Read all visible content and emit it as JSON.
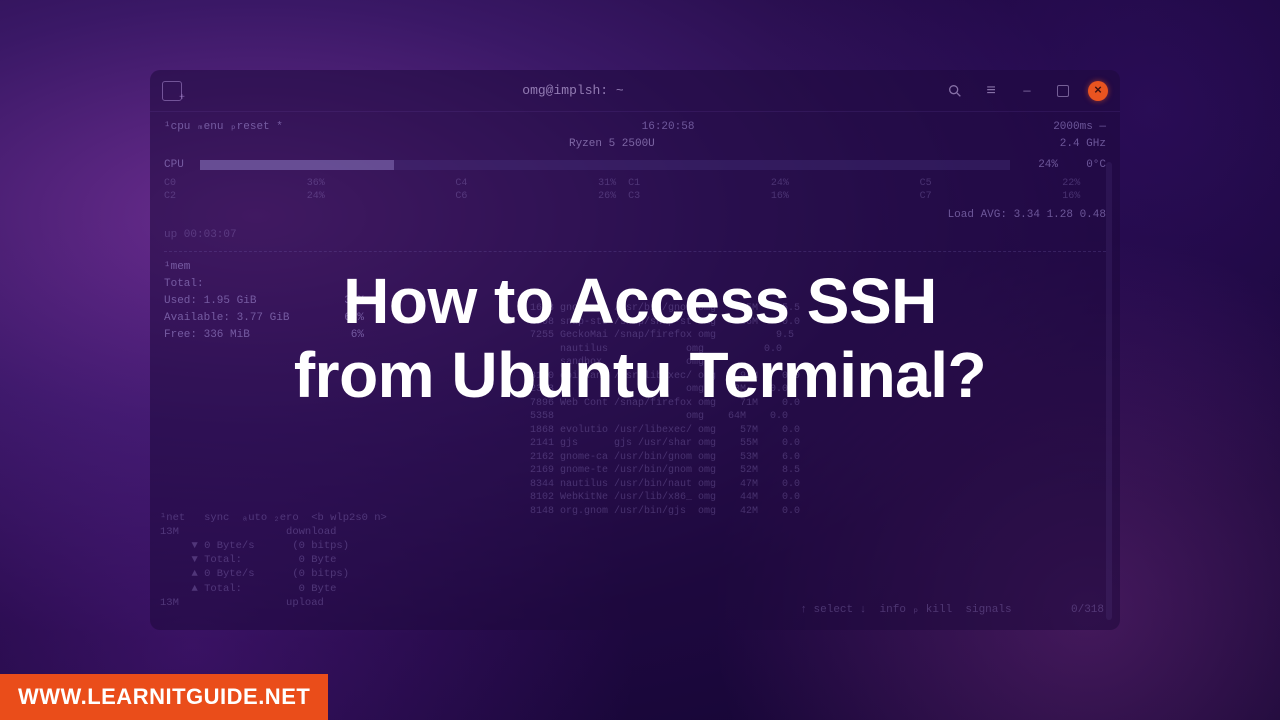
{
  "window": {
    "title": "omg@implsh: ~"
  },
  "topbar": {
    "left_labels": "¹cpu   ₘenu  ₚreset *",
    "time": "16:20:58",
    "right_info": "2000ms —",
    "cpu_model": "Ryzen 5 2500U",
    "cpu_freq": "2.4 GHz",
    "cpu_total_label": "CPU",
    "cpu_total_pct": "24%",
    "cpu_temp": "0°C",
    "cores": [
      {
        "name": "C0",
        "pct": "36%",
        "pair": "C4",
        "pair_pct": "31%"
      },
      {
        "name": "C1",
        "pct": "24%",
        "pair": "C5",
        "pair_pct": "22%"
      },
      {
        "name": "C2",
        "pct": "24%",
        "pair": "C6",
        "pair_pct": "26%"
      },
      {
        "name": "C3",
        "pct": "16%",
        "pair": "C7",
        "pair_pct": "16%"
      }
    ],
    "loadavg": "Load AVG:   3.34   1.28   0.48",
    "uptime": "up 00:03:07"
  },
  "mem": {
    "header": "¹mem",
    "total": "Total:",
    "used": "Used:   1.95 GiB",
    "used_pct": "34%",
    "avail": "Available: 3.77 GiB",
    "avail_pct": "66%",
    "free": "Free:    336 MiB",
    "free_pct": "6%"
  },
  "net": {
    "header": "¹net   sync  ₐuto ₂ero  <b wlp2s0 n>",
    "lines": [
      "13M                 download",
      "     ▼ 0 Byte/s      (0 bitps)",
      "     ▼ Total:         0 Byte",
      "     ▲ 0 Byte/s      (0 bitps)",
      "     ▲ Total:         0 Byte",
      "13M                 upload"
    ]
  },
  "procs": {
    "rows": [
      "1618 gnome-sh /usr/bin/gnom omg   315M   15.5",
      "1908 snap-sto /snap/snap-st omg   236M    0.0",
      "7255 GeckoMai /snap/firefox omg          9.5",
      "     nautilus             omg          0.0",
      "     sandbox              omg",
      "8150 epiphany /usr/libexec/ omg    94M    0.0",
      "2303                      omg    73M    0.0",
      "7896 Web Cont /snap/firefox omg    71M    0.0",
      "5358                      omg    64M    0.0",
      "1868 evolutio /usr/libexec/ omg    57M    0.0",
      "2141 gjs      gjs /usr/shar omg    55M    0.0",
      "2162 gnome-ca /usr/bin/gnom omg    53M    6.0",
      "2169 gnome-te /usr/bin/gnom omg    52M    8.5",
      "8344 nautilus /usr/bin/naut omg    47M    0.0",
      "8102 WebKitNe /usr/lib/x86_ omg    44M    0.0",
      "8148 org.gnom /usr/bin/gjs  omg    42M    0.0"
    ]
  },
  "footer": {
    "select": "↑ select ↓  info ₚ kill  signals         0/318"
  },
  "headline_l1": "How to Access SSH",
  "headline_l2": "from Ubuntu Terminal?",
  "watermark": "WWW.LEARNITGUIDE.NET"
}
